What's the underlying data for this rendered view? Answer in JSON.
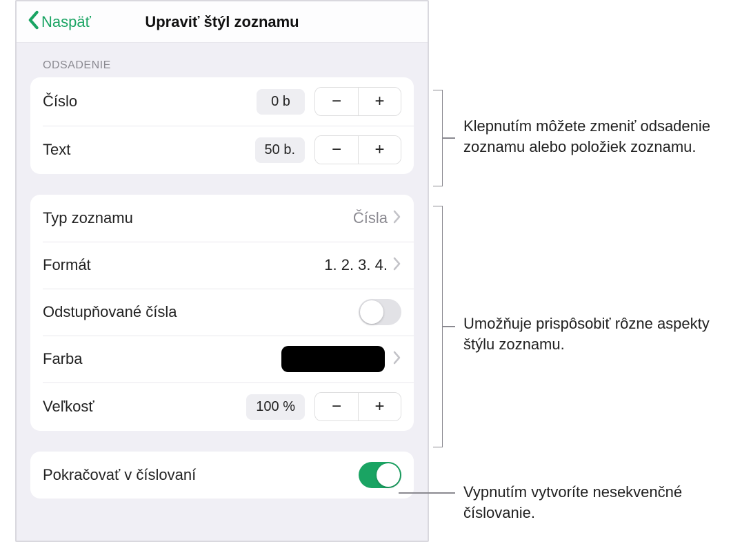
{
  "header": {
    "back_label": "Naspäť",
    "title": "Upraviť štýl zoznamu"
  },
  "section_indent": {
    "label": "ODSADENIE",
    "number": {
      "label": "Číslo",
      "value": "0 b"
    },
    "text": {
      "label": "Text",
      "value": "50 b."
    }
  },
  "section_style": {
    "list_type": {
      "label": "Typ zoznamu",
      "value": "Čísla"
    },
    "format": {
      "label": "Formát",
      "value": "1. 2. 3. 4."
    },
    "tiered": {
      "label": "Odstupňované čísla",
      "on": false
    },
    "color": {
      "label": "Farba",
      "hex": "#000000"
    },
    "size": {
      "label": "Veľkosť",
      "value": "100 %"
    }
  },
  "section_continue": {
    "continue": {
      "label": "Pokračovať v číslovaní",
      "on": true
    }
  },
  "annotations": {
    "a1": "Klepnutím môžete zmeniť odsadenie zoznamu alebo položiek zoznamu.",
    "a2": "Umožňuje prispôsobiť rôzne aspekty štýlu zoznamu.",
    "a3": "Vypnutím vytvoríte nesekvenčné číslovanie."
  }
}
